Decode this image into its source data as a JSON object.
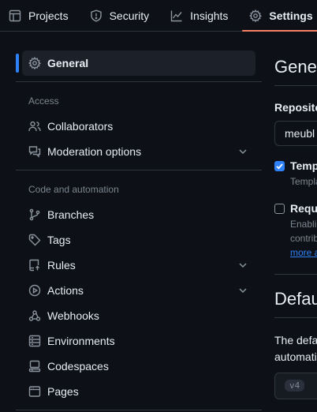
{
  "topnav": {
    "tabs": [
      {
        "label": "Projects",
        "icon": "table-icon"
      },
      {
        "label": "Security",
        "icon": "shield-icon"
      },
      {
        "label": "Insights",
        "icon": "graph-icon"
      },
      {
        "label": "Settings",
        "icon": "gear-icon",
        "active": true
      }
    ]
  },
  "sidebar": {
    "general": {
      "label": "General",
      "icon": "gear-icon"
    },
    "access": {
      "heading": "Access",
      "items": [
        {
          "label": "Collaborators",
          "icon": "people-icon"
        },
        {
          "label": "Moderation options",
          "icon": "comment-discussion-icon",
          "expandable": true
        }
      ]
    },
    "code": {
      "heading": "Code and automation",
      "items": [
        {
          "label": "Branches",
          "icon": "git-branch-icon"
        },
        {
          "label": "Tags",
          "icon": "tag-icon"
        },
        {
          "label": "Rules",
          "icon": "repo-push-icon",
          "expandable": true
        },
        {
          "label": "Actions",
          "icon": "play-icon",
          "expandable": true
        },
        {
          "label": "Webhooks",
          "icon": "webhook-icon"
        },
        {
          "label": "Environments",
          "icon": "server-icon"
        },
        {
          "label": "Codespaces",
          "icon": "codespaces-icon"
        },
        {
          "label": "Pages",
          "icon": "browser-icon"
        }
      ]
    }
  },
  "main": {
    "title": "Gene",
    "repo_label": "Reposito",
    "repo_value": "meubl",
    "template": {
      "label": "Temp",
      "checked": true,
      "note": "Templa"
    },
    "require": {
      "label": "Requi",
      "checked": false,
      "note1": "Enablin",
      "note2": "contrib",
      "link": "more a"
    },
    "default_heading": "Defau",
    "default_text1": "The defa",
    "default_text2": "automati",
    "branch": "v4"
  },
  "colors": {
    "background": "#0d1117",
    "accent": "#2f81f7",
    "active_tab_underline": "#f78166",
    "border": "#30363d",
    "muted": "#7d8590"
  }
}
